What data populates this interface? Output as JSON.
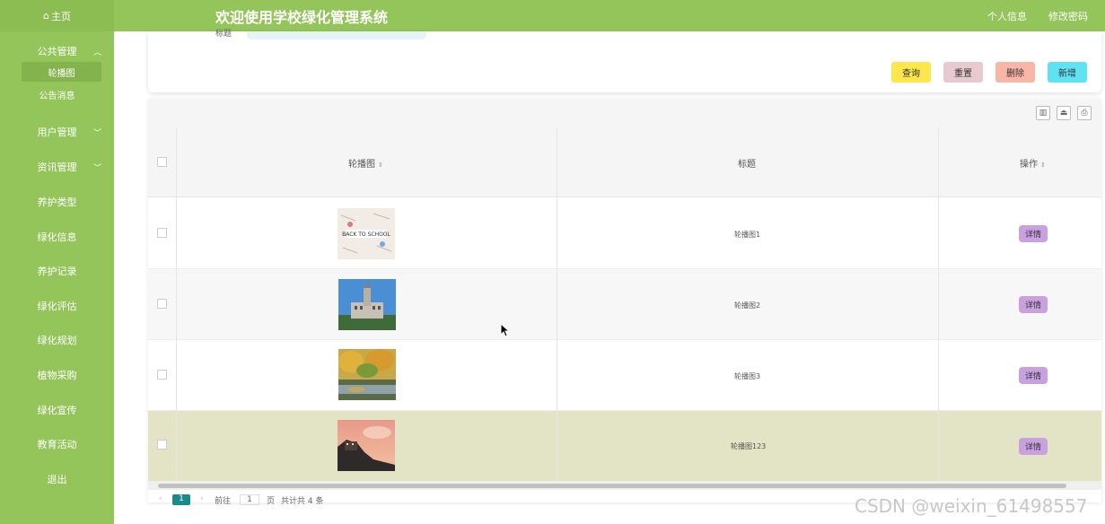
{
  "header": {
    "home": "主页",
    "title": "欢迎使用学校绿化管理系统",
    "profile": "个人信息",
    "change_password": "修改密码"
  },
  "sidebar": {
    "items": [
      {
        "label": "公共管理",
        "expanded": true
      },
      {
        "label": "轮播图",
        "sub": true,
        "active": true
      },
      {
        "label": "公告消息",
        "sub": true
      },
      {
        "label": "用户管理",
        "expandable": true
      },
      {
        "label": "资讯管理",
        "expandable": true
      },
      {
        "label": "养护类型"
      },
      {
        "label": "绿化信息"
      },
      {
        "label": "养护记录"
      },
      {
        "label": "绿化评估"
      },
      {
        "label": "绿化规划"
      },
      {
        "label": "植物采购"
      },
      {
        "label": "绿化宣传"
      },
      {
        "label": "教育活动"
      },
      {
        "label": "退出"
      }
    ]
  },
  "search": {
    "label": "标题",
    "buttons": {
      "query": "查询",
      "reset": "重置",
      "delete": "删除",
      "add": "新增"
    },
    "colors": {
      "query": "#fde74c",
      "reset": "#e8c9cf",
      "delete": "#f9b5a6",
      "add": "#5fe3f2"
    }
  },
  "table": {
    "headers": {
      "image": "轮播图",
      "title": "标题",
      "action": "操作"
    },
    "rows": [
      {
        "title": "轮播图1",
        "action": "详情"
      },
      {
        "title": "轮播图2",
        "action": "详情"
      },
      {
        "title": "轮播图3",
        "action": "详情"
      },
      {
        "title": "轮播图123",
        "action": "详情"
      }
    ]
  },
  "pagination": {
    "current_page": "1",
    "goto_label": "前往",
    "goto_value": "1",
    "page_unit": "页",
    "total": "共计共 4 条"
  },
  "watermark": "CSDN @weixin_61498557",
  "colors": {
    "accent": "#93c55a",
    "selected_row": "#e3e3c5",
    "detail_button": "#c9a0e0"
  }
}
